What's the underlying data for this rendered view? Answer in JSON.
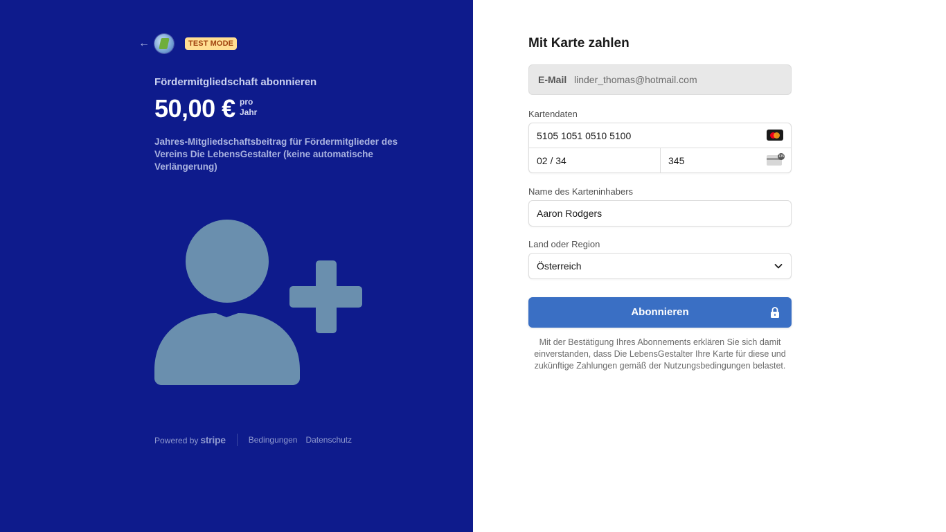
{
  "header": {
    "badge": "TEST MODE"
  },
  "product": {
    "name": "Fördermitgliedschaft abonnieren",
    "price": "50,00 €",
    "interval_pro": "pro",
    "interval_unit": "Jahr",
    "description": "Jahres-Mitgliedschaftsbeitrag für Fördermitglieder des Vereins Die LebensGestalter (keine automatische Verlängerung)",
    "illustration_icon": "user-plus-icon"
  },
  "footer": {
    "powered_by": "Powered by",
    "brand": "stripe",
    "terms": "Bedingungen",
    "privacy": "Datenschutz"
  },
  "payment": {
    "title": "Mit Karte zahlen",
    "email_label": "E-Mail",
    "email_value": "linder_thomas@hotmail.com",
    "card_label": "Kartendaten",
    "card_number": "5105 1051 0510 5100",
    "card_brand_icon": "mastercard-icon",
    "expiry": "02 / 34",
    "cvc": "345",
    "cvc_icon": "cvc-card-icon",
    "cvc_icon_text": "135",
    "name_label": "Name des Karteninhabers",
    "name_value": "Aaron Rodgers",
    "country_label": "Land oder Region",
    "country_value": "Österreich",
    "submit_label": "Abonnieren",
    "legal": "Mit der Bestätigung Ihres Abonnements erklären Sie sich damit einverstanden, dass Die LebensGestalter Ihre Karte für diese und zukünftige Zahlungen gemäß der Nutzungsbedingungen belastet."
  },
  "colors": {
    "left_panel": "#0e1b8c",
    "button": "#3a6fc4",
    "illustration": "#6a8fae",
    "badge_bg": "#ffde92"
  }
}
